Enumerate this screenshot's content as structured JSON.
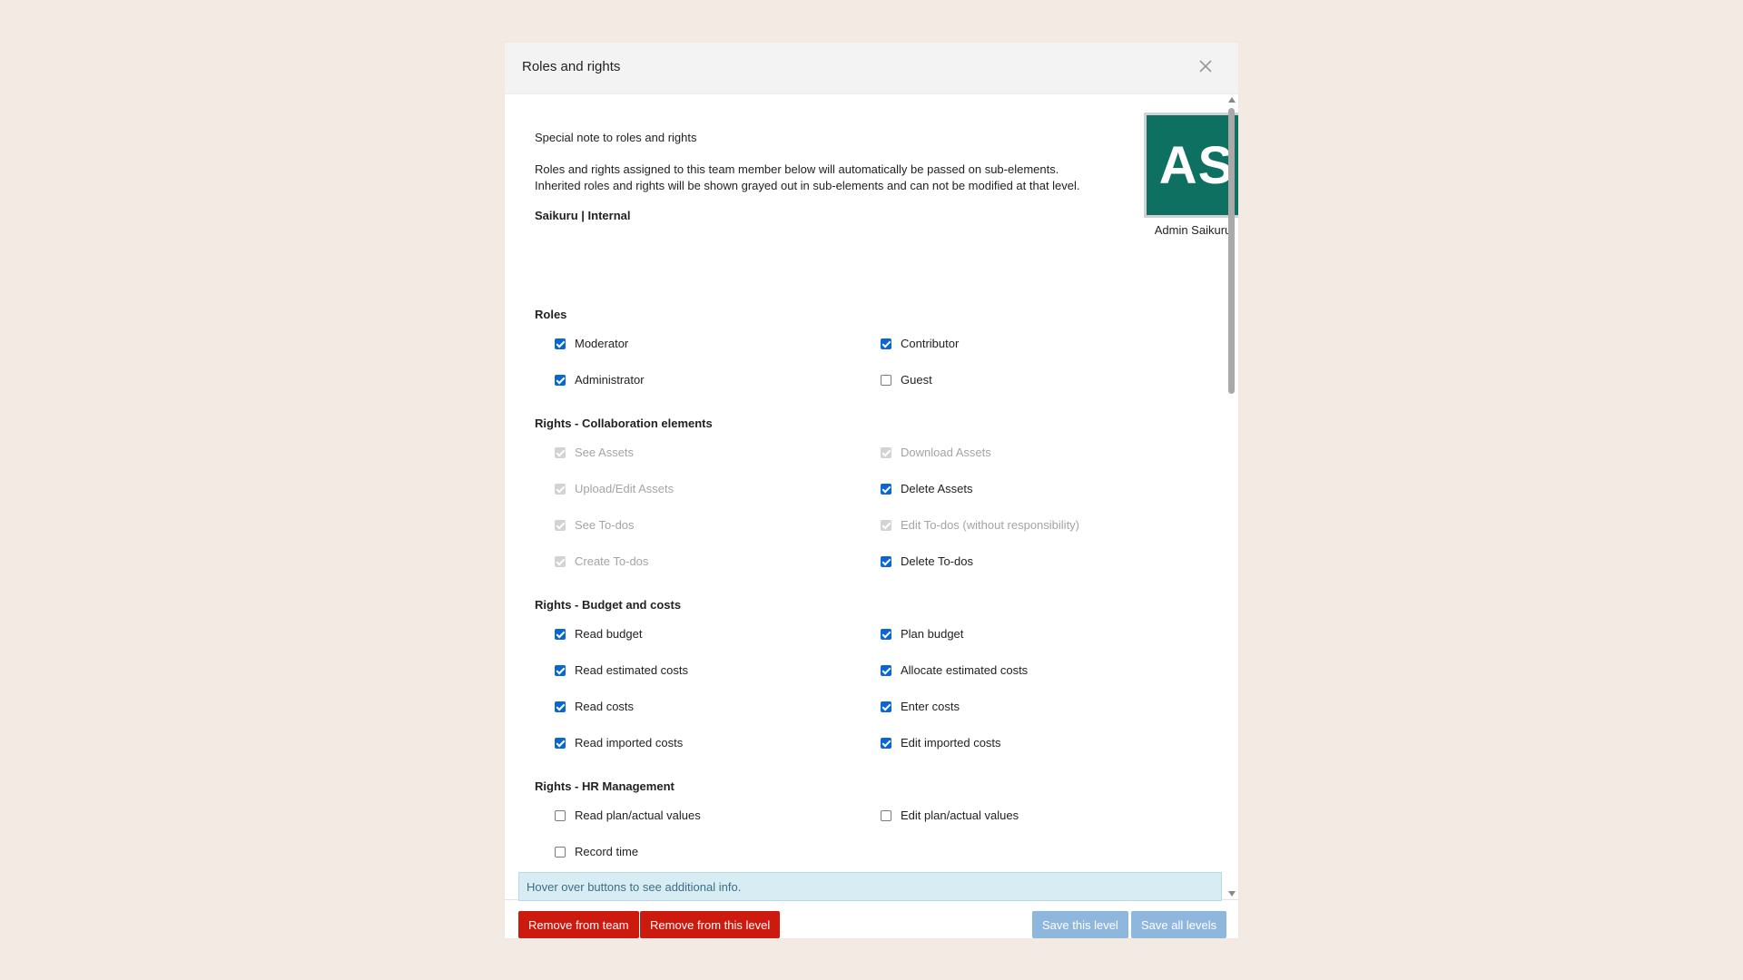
{
  "dialog": {
    "title": "Roles and rights"
  },
  "note": {
    "title": "Special note to roles and rights",
    "line1": "Roles and rights assigned to this team member below will automatically be passed on sub-elements.",
    "line2": "Inherited roles and rights will be shown grayed out in sub-elements and can not be modified at that level.",
    "team": "Saikuru | Internal"
  },
  "user": {
    "initials": "AS",
    "name": "Admin Saikuru",
    "avatar_color": "#0e7060"
  },
  "sections": {
    "roles": {
      "title": "Roles",
      "items": [
        {
          "label": "Moderator",
          "checked": true,
          "disabled": false
        },
        {
          "label": "Contributor",
          "checked": true,
          "disabled": false
        },
        {
          "label": "Administrator",
          "checked": true,
          "disabled": false
        },
        {
          "label": "Guest",
          "checked": false,
          "disabled": false
        }
      ]
    },
    "collab": {
      "title": "Rights - Collaboration elements",
      "items": [
        {
          "label": "See Assets",
          "checked": true,
          "disabled": true
        },
        {
          "label": "Download Assets",
          "checked": true,
          "disabled": true
        },
        {
          "label": "Upload/Edit Assets",
          "checked": true,
          "disabled": true
        },
        {
          "label": "Delete Assets",
          "checked": true,
          "disabled": false
        },
        {
          "label": "See To-dos",
          "checked": true,
          "disabled": true
        },
        {
          "label": "Edit To-dos (without responsibility)",
          "checked": true,
          "disabled": true
        },
        {
          "label": "Create To-dos",
          "checked": true,
          "disabled": true
        },
        {
          "label": "Delete To-dos",
          "checked": true,
          "disabled": false
        }
      ]
    },
    "budget": {
      "title": "Rights - Budget and costs",
      "items": [
        {
          "label": "Read budget",
          "checked": true,
          "disabled": false
        },
        {
          "label": "Plan budget",
          "checked": true,
          "disabled": false
        },
        {
          "label": "Read estimated costs",
          "checked": true,
          "disabled": false
        },
        {
          "label": "Allocate estimated costs",
          "checked": true,
          "disabled": false
        },
        {
          "label": "Read costs",
          "checked": true,
          "disabled": false
        },
        {
          "label": "Enter costs",
          "checked": true,
          "disabled": false
        },
        {
          "label": "Read imported costs",
          "checked": true,
          "disabled": false
        },
        {
          "label": "Edit imported costs",
          "checked": true,
          "disabled": false
        }
      ]
    },
    "hr": {
      "title": "Rights - HR Management",
      "items": [
        {
          "label": "Read plan/actual values",
          "checked": false,
          "disabled": false
        },
        {
          "label": "Edit plan/actual values",
          "checked": false,
          "disabled": false
        },
        {
          "label": "Record time",
          "checked": false,
          "disabled": false
        }
      ]
    }
  },
  "footer": {
    "info": "Hover over buttons to see additional info.",
    "remove_team": "Remove from team",
    "remove_level": "Remove from this level",
    "save_level": "Save this level",
    "save_all": "Save all levels"
  },
  "colors": {
    "checkbox_checked": "#0a66d6",
    "danger": "#cc1a0e",
    "primary_disabled": "#8fb6dd",
    "info_bg": "#d8ecf4"
  }
}
